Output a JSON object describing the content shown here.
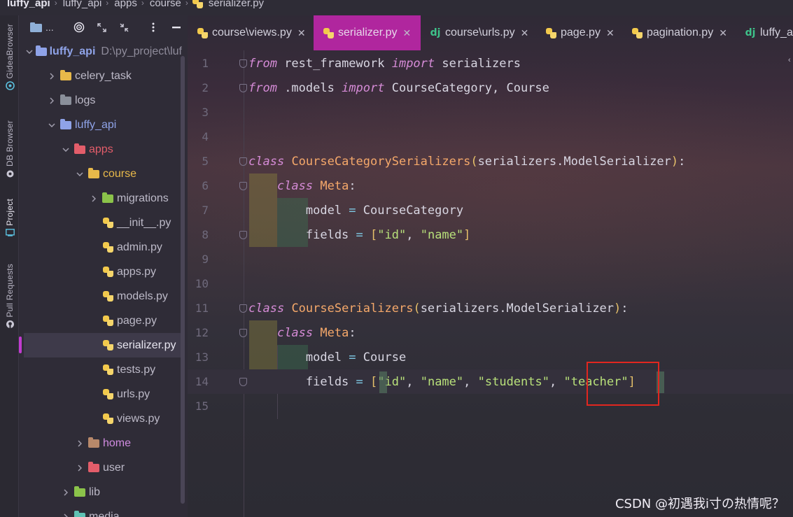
{
  "breadcrumb": [
    "luffy_api",
    "luffy_api",
    "apps",
    "course",
    "serializer.py"
  ],
  "toolstrip": [
    {
      "label": "GideaBrowser",
      "icon": "chrome-icon"
    },
    {
      "label": "DB Browser",
      "icon": "database-icon"
    },
    {
      "label": "Project",
      "icon": "project-icon"
    },
    {
      "label": "Pull Requests",
      "icon": "github-icon"
    }
  ],
  "panel": {
    "title": "..."
  },
  "tree": [
    {
      "label": "luffy_api",
      "sub": "D:\\py_project\\luf",
      "type": "folder",
      "color": "#8fa3e8",
      "chev": "open",
      "indent": 0,
      "bold": true
    },
    {
      "label": "celery_task",
      "type": "folder",
      "color": "#e8b94a",
      "chev": "closed",
      "indent": 1
    },
    {
      "label": "logs",
      "type": "folder",
      "color": "#8a8f9a",
      "chev": "closed",
      "indent": 1
    },
    {
      "label": "luffy_api",
      "type": "folder",
      "color": "#8fa3e8",
      "chev": "open",
      "indent": 1,
      "accent": "#8fa3e8"
    },
    {
      "label": "apps",
      "type": "folder",
      "color": "#e35d6a",
      "chev": "open",
      "indent": 2,
      "accent": "#e35d6a"
    },
    {
      "label": "course",
      "type": "folder",
      "color": "#e8b94a",
      "chev": "open",
      "indent": 3,
      "accent": "#e8b94a"
    },
    {
      "label": "migrations",
      "type": "folder",
      "color": "#8bc34a",
      "chev": "closed",
      "indent": 4
    },
    {
      "label": "__init__.py",
      "type": "py",
      "indent": 4
    },
    {
      "label": "admin.py",
      "type": "py",
      "indent": 4
    },
    {
      "label": "apps.py",
      "type": "py",
      "indent": 4
    },
    {
      "label": "models.py",
      "type": "py",
      "indent": 4
    },
    {
      "label": "page.py",
      "type": "py",
      "indent": 4
    },
    {
      "label": "serializer.py",
      "type": "py",
      "indent": 4,
      "selected": true
    },
    {
      "label": "tests.py",
      "type": "py",
      "indent": 4
    },
    {
      "label": "urls.py",
      "type": "py",
      "indent": 4
    },
    {
      "label": "views.py",
      "type": "py",
      "indent": 4
    },
    {
      "label": "home",
      "type": "folder",
      "color": "#b8896a",
      "chev": "closed",
      "indent": 3,
      "accent": "#d08be0"
    },
    {
      "label": "user",
      "type": "folder",
      "color": "#e35d6a",
      "chev": "closed",
      "indent": 3
    },
    {
      "label": "lib",
      "type": "folder",
      "color": "#8bc34a",
      "chev": "closed",
      "indent": 2
    },
    {
      "label": "media",
      "type": "folder",
      "color": "#5fc1b3",
      "chev": "closed",
      "indent": 2
    }
  ],
  "tabs": [
    {
      "label": "course\\views.py",
      "icon": "python",
      "active": false
    },
    {
      "label": "serializer.py",
      "icon": "python",
      "active": true
    },
    {
      "label": "course\\urls.py",
      "icon": "django",
      "active": false
    },
    {
      "label": "page.py",
      "icon": "python",
      "active": false
    },
    {
      "label": "pagination.py",
      "icon": "python",
      "active": false
    },
    {
      "label": "luffy_a",
      "icon": "django",
      "active": false
    }
  ],
  "code": {
    "line_numbers": [
      "1",
      "2",
      "3",
      "4",
      "5",
      "6",
      "7",
      "8",
      "9",
      "10",
      "11",
      "12",
      "13",
      "14",
      "15"
    ],
    "lines": [
      [
        {
          "t": "from",
          "c": "kw"
        },
        {
          "t": " rest_framework ",
          "c": "ref"
        },
        {
          "t": "import",
          "c": "kw"
        },
        {
          "t": " serializers",
          "c": "ref"
        }
      ],
      [
        {
          "t": "from",
          "c": "kw"
        },
        {
          "t": " .models ",
          "c": "ref"
        },
        {
          "t": "import",
          "c": "kw"
        },
        {
          "t": " CourseCategory, Course",
          "c": "ref"
        }
      ],
      [],
      [],
      [
        {
          "t": "class",
          "c": "kw"
        },
        {
          "t": " ",
          "c": "ref"
        },
        {
          "t": "CourseCategorySerializers",
          "c": "cls"
        },
        {
          "t": "(",
          "c": "par"
        },
        {
          "t": "serializers.ModelSerializer",
          "c": "ref"
        },
        {
          "t": ")",
          "c": "par"
        },
        {
          "t": ":",
          "c": "punc"
        }
      ],
      [
        {
          "t": "    ",
          "c": "ref"
        },
        {
          "t": "class",
          "c": "kw"
        },
        {
          "t": " ",
          "c": "ref"
        },
        {
          "t": "Meta",
          "c": "cls"
        },
        {
          "t": ":",
          "c": "punc"
        }
      ],
      [
        {
          "t": "        model ",
          "c": "ref"
        },
        {
          "t": "=",
          "c": "op"
        },
        {
          "t": " CourseCategory",
          "c": "ref"
        }
      ],
      [
        {
          "t": "        fields ",
          "c": "ref"
        },
        {
          "t": "=",
          "c": "op"
        },
        {
          "t": " ",
          "c": "ref"
        },
        {
          "t": "[",
          "c": "par"
        },
        {
          "t": "\"id\"",
          "c": "str"
        },
        {
          "t": ", ",
          "c": "punc"
        },
        {
          "t": "\"name\"",
          "c": "str"
        },
        {
          "t": "]",
          "c": "par"
        }
      ],
      [],
      [],
      [
        {
          "t": "class",
          "c": "kw"
        },
        {
          "t": " ",
          "c": "ref"
        },
        {
          "t": "CourseSerializers",
          "c": "cls"
        },
        {
          "t": "(",
          "c": "par"
        },
        {
          "t": "serializers.ModelSerializer",
          "c": "ref"
        },
        {
          "t": ")",
          "c": "par"
        },
        {
          "t": ":",
          "c": "punc"
        }
      ],
      [
        {
          "t": "    ",
          "c": "ref"
        },
        {
          "t": "class",
          "c": "kw"
        },
        {
          "t": " ",
          "c": "ref"
        },
        {
          "t": "Meta",
          "c": "cls"
        },
        {
          "t": ":",
          "c": "punc"
        }
      ],
      [
        {
          "t": "        model ",
          "c": "ref"
        },
        {
          "t": "=",
          "c": "op"
        },
        {
          "t": " Course",
          "c": "ref"
        }
      ],
      [
        {
          "t": "        fields ",
          "c": "ref"
        },
        {
          "t": "=",
          "c": "op"
        },
        {
          "t": " ",
          "c": "ref"
        },
        {
          "t": "[",
          "c": "par"
        },
        {
          "t": "\"id\"",
          "c": "str"
        },
        {
          "t": ", ",
          "c": "punc"
        },
        {
          "t": "\"name\"",
          "c": "str"
        },
        {
          "t": ", ",
          "c": "punc"
        },
        {
          "t": "\"students\"",
          "c": "str"
        },
        {
          "t": ", ",
          "c": "punc"
        },
        {
          "t": "\"teacher\"",
          "c": "str"
        },
        {
          "t": "]",
          "c": "par"
        }
      ],
      []
    ],
    "current_line": 14
  },
  "watermark": "CSDN @初遇我ⅰ寸の热情呢？",
  "colors": {
    "active_tab": "#b0269e",
    "selection_marker": "#c13bd0",
    "annotation_box": "#e1261f"
  }
}
